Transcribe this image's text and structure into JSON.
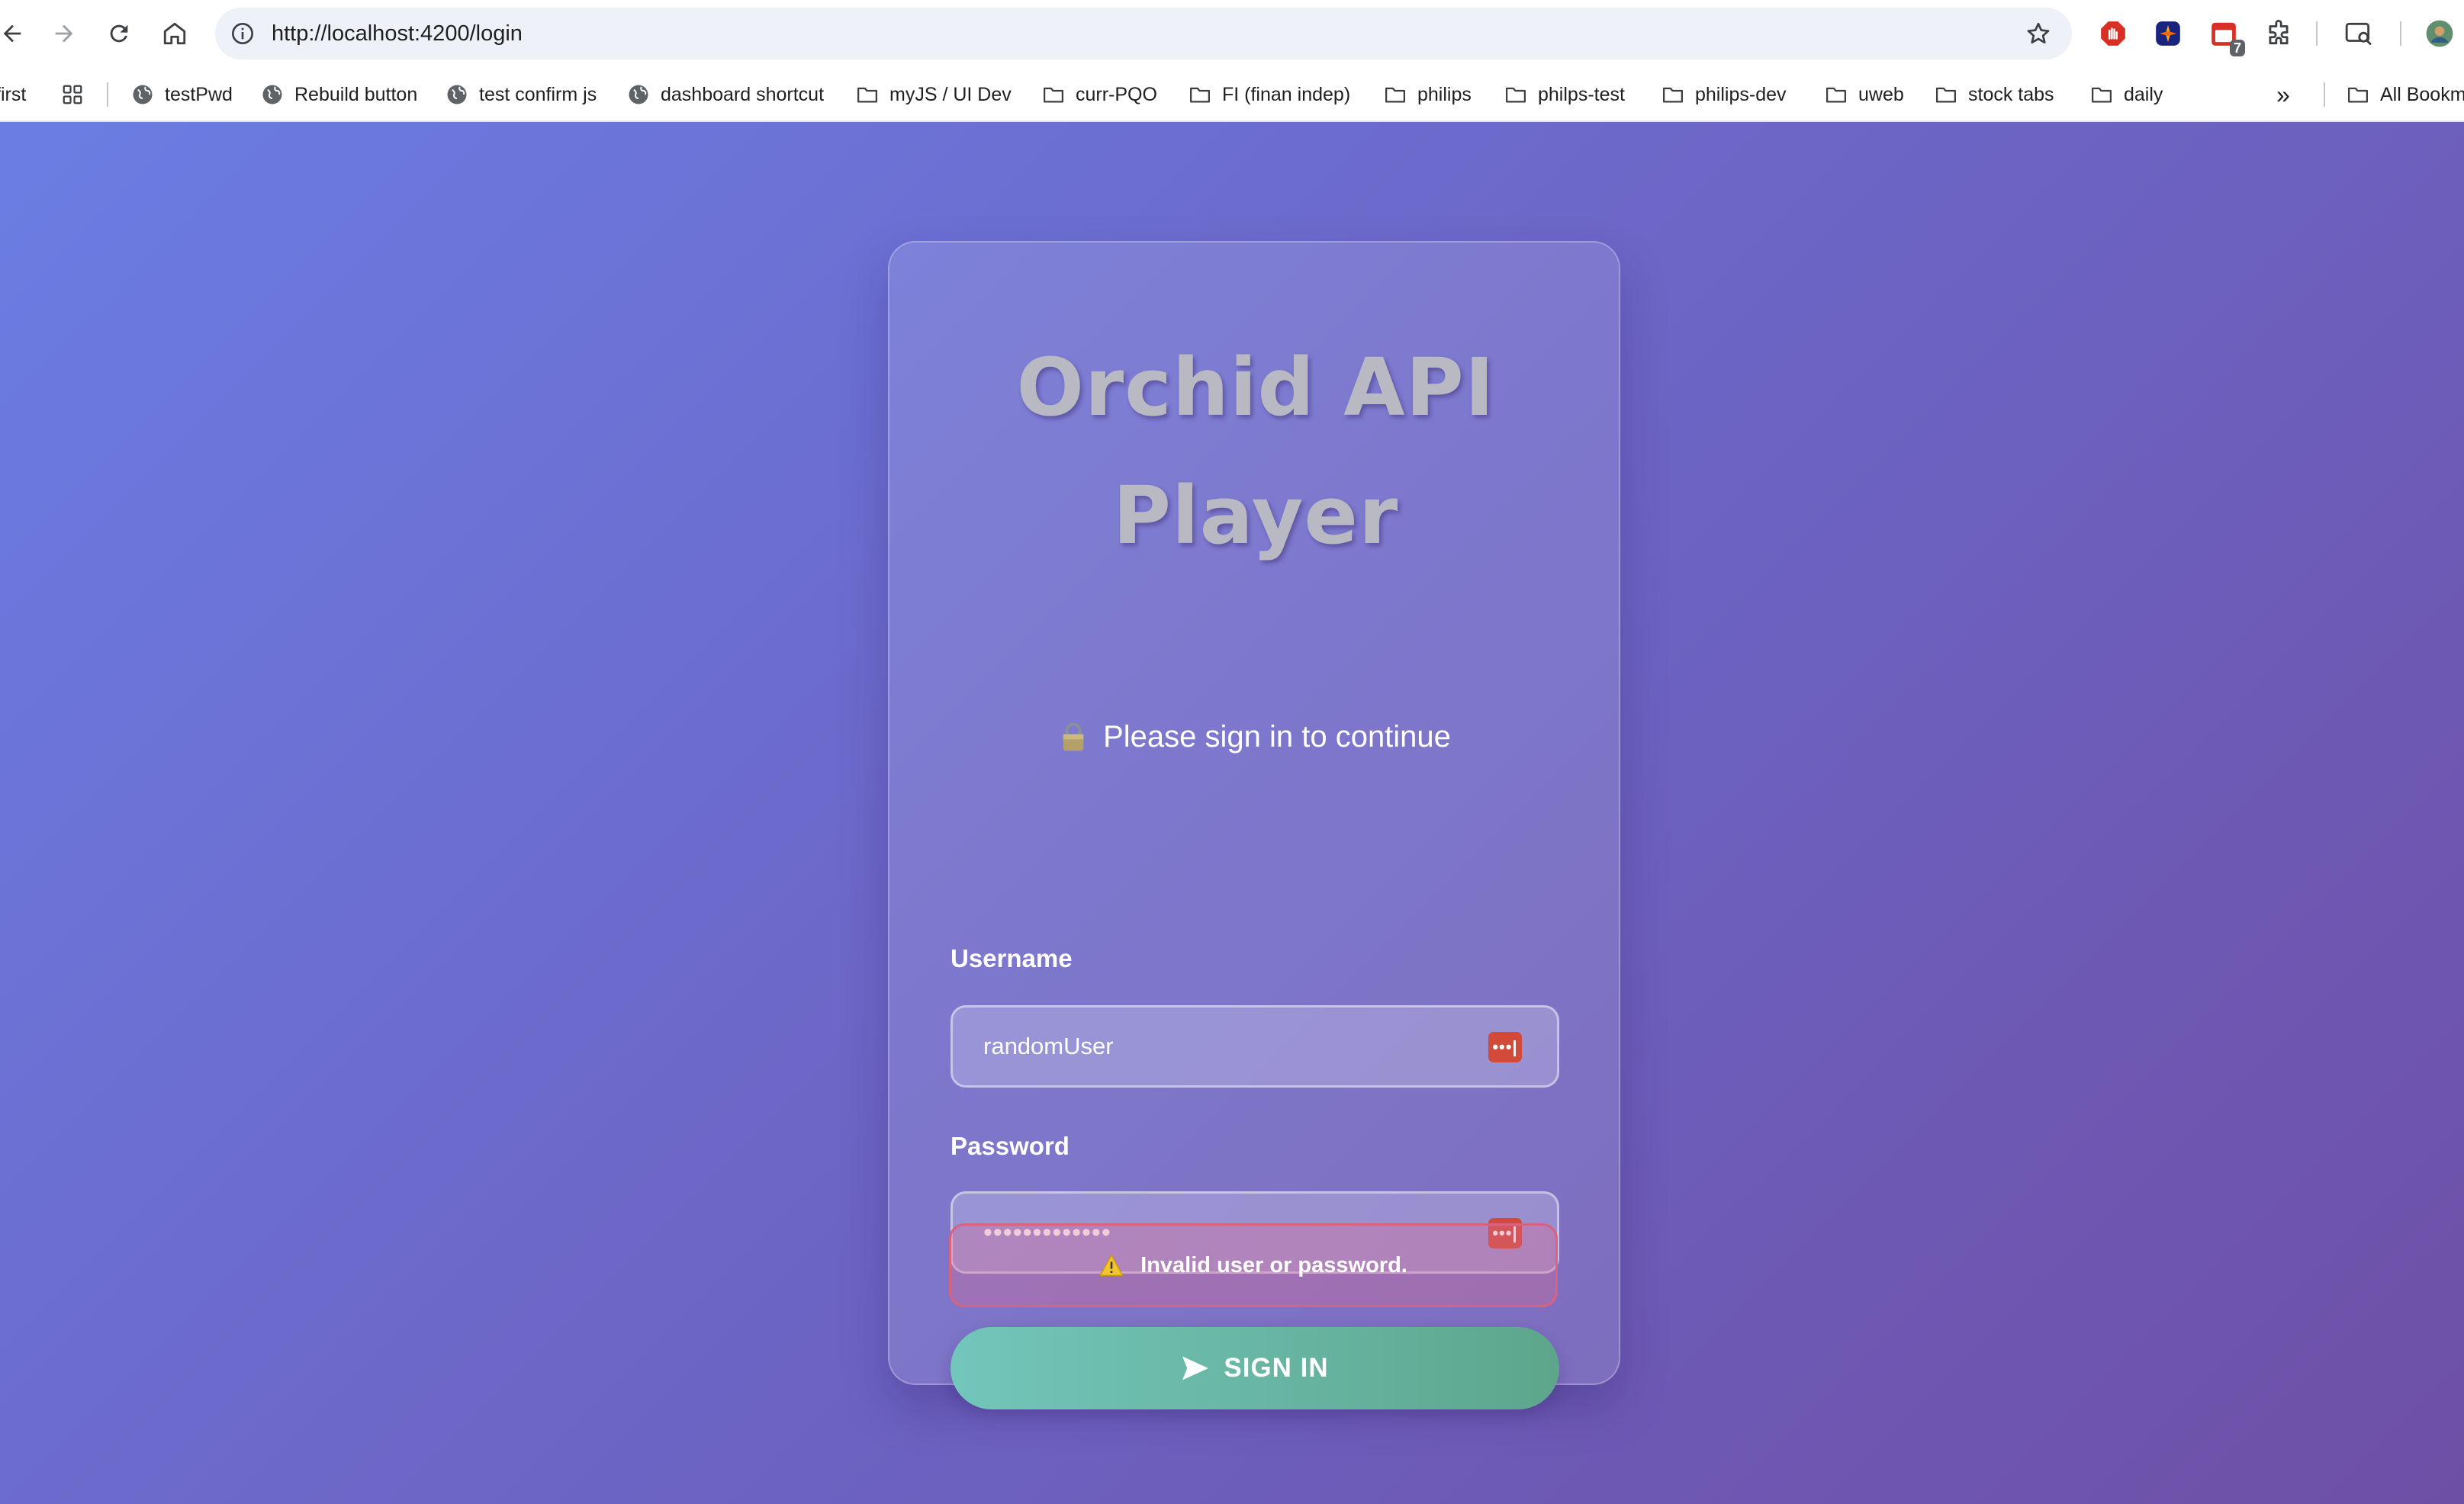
{
  "browser": {
    "url": "http://localhost:4200/login",
    "extension_badge": "7"
  },
  "bookmarks": {
    "items": [
      {
        "label": "first",
        "icon": "none"
      },
      {
        "label": "testPwd",
        "icon": "globe-icon"
      },
      {
        "label": "Rebuild button",
        "icon": "globe-icon"
      },
      {
        "label": "test confirm js",
        "icon": "globe-icon"
      },
      {
        "label": "dashboard shortcut",
        "icon": "globe-icon"
      },
      {
        "label": "myJS / UI Dev",
        "icon": "folder-icon"
      },
      {
        "label": "curr-PQO",
        "icon": "folder-icon"
      },
      {
        "label": "FI (finan indep)",
        "icon": "folder-icon"
      },
      {
        "label": "philips",
        "icon": "folder-icon"
      },
      {
        "label": "philps-test",
        "icon": "folder-icon"
      },
      {
        "label": "philips-dev",
        "icon": "folder-icon"
      },
      {
        "label": "uweb",
        "icon": "folder-icon"
      },
      {
        "label": "stock tabs",
        "icon": "folder-icon"
      },
      {
        "label": "daily",
        "icon": "folder-icon"
      }
    ],
    "overflow": "»",
    "all_bookmarks": "All Bookm"
  },
  "login": {
    "title_line1": "Orchid API",
    "title_line2": "Player",
    "subtitle": "Please sign in to continue",
    "username_label": "Username",
    "username_value": "randomUser",
    "password_label": "Password",
    "password_value": "•••••••••••••",
    "signin_label": "SIGN IN",
    "error_message": "Invalid user or password."
  },
  "colors": {
    "background_start": "#6b7de3",
    "background_end": "#6e4fa6",
    "signin_button": "#6abaa8",
    "error_border": "#d9627f",
    "password_manager_icon": "#d24a3a"
  }
}
